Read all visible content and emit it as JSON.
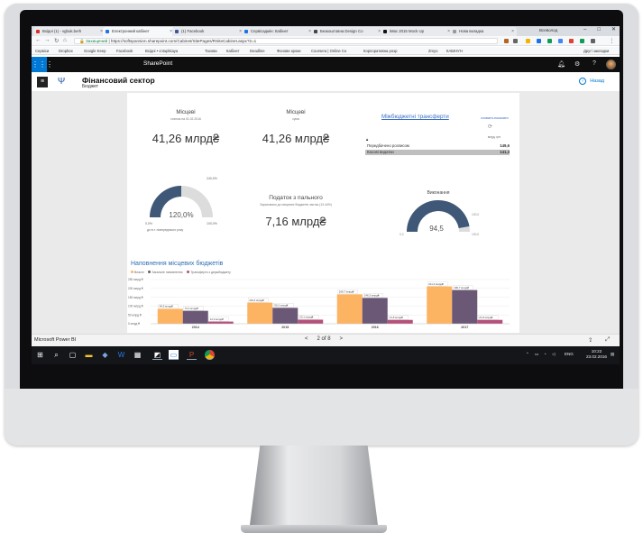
{
  "browser": {
    "tabs": [
      {
        "label": "Вхідні (1) - vgbuk.berh",
        "color": "#d93025"
      },
      {
        "label": "Електронний кабінет",
        "color": "#1a73e8"
      },
      {
        "label": "(1) Facebook",
        "color": "#3b5998"
      },
      {
        "label": "Сервісадмін: Кабінет",
        "color": "#1a73e8"
      },
      {
        "label": "Безкоштовна Design Co",
        "color": "#444"
      },
      {
        "label": "iMac 2015 Mock Up",
        "color": "#111"
      },
      {
        "label": "Нова вкладка",
        "color": "#999"
      }
    ],
    "profile_name": "Всеволод",
    "window_min": "–",
    "window_max": "□",
    "window_close": "✕",
    "secure_label": "Захищений",
    "url": "https://softspansion.sharepoint.com/Cabinet/SitePages/RSiteCabinet.aspx?2=1",
    "bookmarks": [
      "Сервіси",
      "Dropbox",
      "Google Keep",
      "Facebook",
      "Вхідні • cntuplsiaya",
      "Тахова",
      "Кабінет",
      "Deadline",
      "Фонове кроки",
      "Coursera | Online Co",
      "Корпоративна розр",
      "Zmyo",
      "КАБІНУН",
      "Другі закладки"
    ]
  },
  "sharepoint": {
    "app_name": "SharePoint",
    "waffle_icon": "waffle-icon",
    "site_title": "Фінансовий сектор",
    "site_subtitle": "Бюджет",
    "back_label": "Назад"
  },
  "report": {
    "kpi1": {
      "title": "Місцеві",
      "subtitle": "станом на 01.02.2016",
      "value": "41,26 млрд₴"
    },
    "kpi2": {
      "title": "Місцеві",
      "subtitle": "сума",
      "value": "41,26 млрд₴"
    },
    "gauge1": {
      "value_label": "120,0%",
      "min_label": "0,0%",
      "max_label": "100,0%",
      "target_label": "240,0%",
      "caption": "до в.т. попереднього року",
      "fraction": 0.5
    },
    "kpi3": {
      "title": "Податок з пального",
      "subtitle": "Зараховано до місцевих бюджетів частка (13.44%)",
      "value": "7,16 млрд₴"
    },
    "transfers": {
      "title": "Міжбюджетні трансферти",
      "hide_label": "сховати-показати",
      "header": "млрд. грн",
      "rows": [
        {
          "label": "Передбачено розписом",
          "value": "149,6"
        },
        {
          "label": "Касові видатки",
          "value": "141,3"
        }
      ]
    },
    "gauge2": {
      "title": "Виконання",
      "value_label": "94,5",
      "min_label": "0,0",
      "max_label": "100,0",
      "target_label": "100,0",
      "fraction": 0.945
    }
  },
  "chart_data": {
    "type": "bar",
    "title": "Наповнення місцевих бюджетів",
    "categories": [
      "2014",
      "2015",
      "2016",
      "2017"
    ],
    "series": [
      {
        "name": "Власні",
        "color": "#fdb462",
        "values": [
          84.5,
          119.4,
          166.7,
          211.3
        ],
        "labels": [
          "84,5 млрд₴",
          "119,4 млрд₴",
          "166,7 млрд₴",
          "211,3 млрд₴"
        ]
      },
      {
        "name": "Загальне наповнення",
        "color": "#6b5876",
        "values": [
          73.1,
          90.2,
          146.3,
          190.7
        ],
        "labels": [
          "73,1 млрд₴",
          "90,2 млрд₴",
          "146,3 млрд₴",
          "190,7 млрд₴"
        ]
      },
      {
        "name": "Трансферти з держбюджету",
        "color": "#b5507a",
        "values": [
          12.3,
          23.1,
          21.8,
          21.8
        ],
        "labels": [
          "12,3 млрд₴",
          "23,1 млрд₴",
          "21,8 млрд₴",
          "21,8 млрд₴"
        ]
      }
    ],
    "ylim": [
      0,
      250
    ],
    "ticks": [
      0,
      50,
      100,
      150,
      200,
      250
    ],
    "tick_labels": [
      "0 млрд ₴",
      "50 млрд ₴",
      "100 млрд ₴",
      "150 млрд ₴",
      "200 млрд ₴",
      "250 млрд ₴"
    ],
    "grid": true,
    "legend": "top-left"
  },
  "powerbi": {
    "brand": "Microsoft Power BI",
    "page_label": "2 of 8",
    "prev": "<",
    "next": ">"
  },
  "taskbar": {
    "language": "ENG",
    "time": "10:22",
    "date": "23.02.2016"
  },
  "colors": {
    "accent": "#0078d4",
    "gauge": "#3f5877",
    "gauge_bg": "#dcdcdc"
  }
}
